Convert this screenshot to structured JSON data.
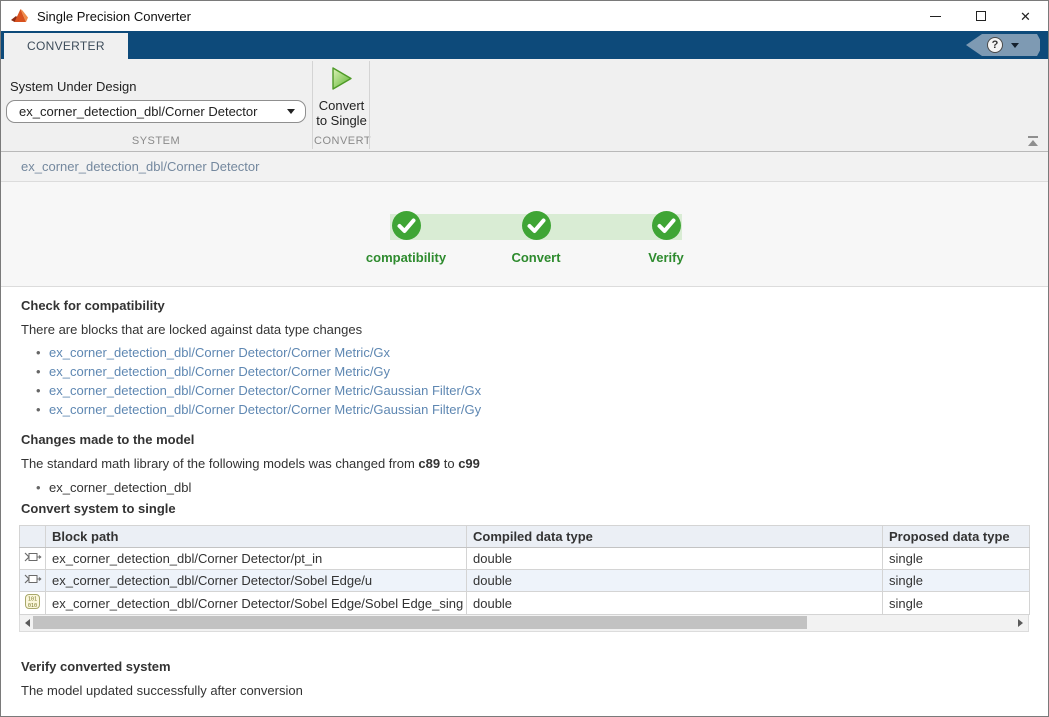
{
  "window": {
    "title": "Single Precision Converter",
    "controls": {
      "minimize": "minimize",
      "maximize": "maximize",
      "close": "close"
    }
  },
  "ribbon": {
    "tab_label": "CONVERTER",
    "help_label": "?"
  },
  "toolbar": {
    "system_label": "System Under Design",
    "system_value": "ex_corner_detection_dbl/Corner Detector",
    "system_section": "SYSTEM",
    "convert_button_label": "Convert to Single",
    "convert_section": "CONVERT"
  },
  "breadcrumb": "ex_corner_detection_dbl/Corner Detector",
  "progress": {
    "steps": [
      {
        "label": "compatibility",
        "state": "done"
      },
      {
        "label": "Convert",
        "state": "done"
      },
      {
        "label": "Verify",
        "state": "done"
      }
    ]
  },
  "compatibility": {
    "heading": "Check for compatibility",
    "text": "There are blocks that are locked against data type changes",
    "links": [
      "ex_corner_detection_dbl/Corner Detector/Corner Metric/Gx",
      "ex_corner_detection_dbl/Corner Detector/Corner Metric/Gy",
      "ex_corner_detection_dbl/Corner Detector/Corner Metric/Gaussian Filter/Gx",
      "ex_corner_detection_dbl/Corner Detector/Corner Metric/Gaussian Filter/Gy"
    ]
  },
  "changes": {
    "heading": "Changes made to the model",
    "text_before": "The standard math library of the following models was changed from ",
    "lib_from": "c89",
    "text_between": " to ",
    "lib_to": "c99",
    "items": [
      "ex_corner_detection_dbl"
    ]
  },
  "convert": {
    "heading": "Convert system to single",
    "table": {
      "columns": [
        "Block path",
        "Compiled data type",
        "Proposed data type"
      ],
      "rows": [
        {
          "icon": "inport",
          "block_path": "ex_corner_detection_dbl/Corner Detector/pt_in",
          "compiled": "double",
          "proposed": "single"
        },
        {
          "icon": "inport",
          "block_path": "ex_corner_detection_dbl/Corner Detector/Sobel Edge/u",
          "compiled": "double",
          "proposed": "single"
        },
        {
          "icon": "binary-block",
          "block_path": "ex_corner_detection_dbl/Corner Detector/Sobel Edge/Sobel Edge_sing",
          "compiled": "double",
          "proposed": "single"
        }
      ]
    }
  },
  "verify": {
    "heading": "Verify converted system",
    "text": "The model updated successfully after conversion"
  },
  "colors": {
    "ribbon_blue": "#0d4a7a",
    "step_green": "#3fa535",
    "step_bar_green": "#d9ecd4",
    "step_label_green": "#2e8b2e",
    "link_blue": "#5e87b2",
    "breadcrumb_blue": "#74889e"
  }
}
